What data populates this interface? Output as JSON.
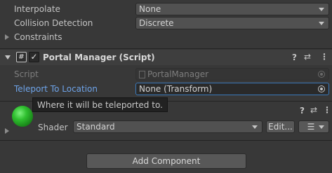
{
  "inspector": {
    "interpolate": {
      "label": "Interpolate",
      "value": "None"
    },
    "collision_detection": {
      "label": "Collision Detection",
      "value": "Discrete"
    },
    "constraints_label": "Constraints"
  },
  "portal_manager": {
    "title": "Portal Manager (Script)",
    "script_label": "Script",
    "script_value": "PortalManager",
    "teleport_label": "Teleport To Location",
    "teleport_value": "None (Transform)",
    "tooltip": "Where it will be teleported to."
  },
  "material": {
    "shader_label": "Shader",
    "shader_value": "Standard",
    "edit_label": "Edit...",
    "list_icon": "☰"
  },
  "footer": {
    "add_component_label": "Add Component"
  },
  "icons": {
    "help": "?",
    "presets": "⇄",
    "menu": "⋮",
    "script": "#",
    "check": "✓"
  },
  "colors": {
    "accent": "#3a79bb",
    "link_label": "#6ea3e8",
    "sphere": "#2fbf2f"
  }
}
